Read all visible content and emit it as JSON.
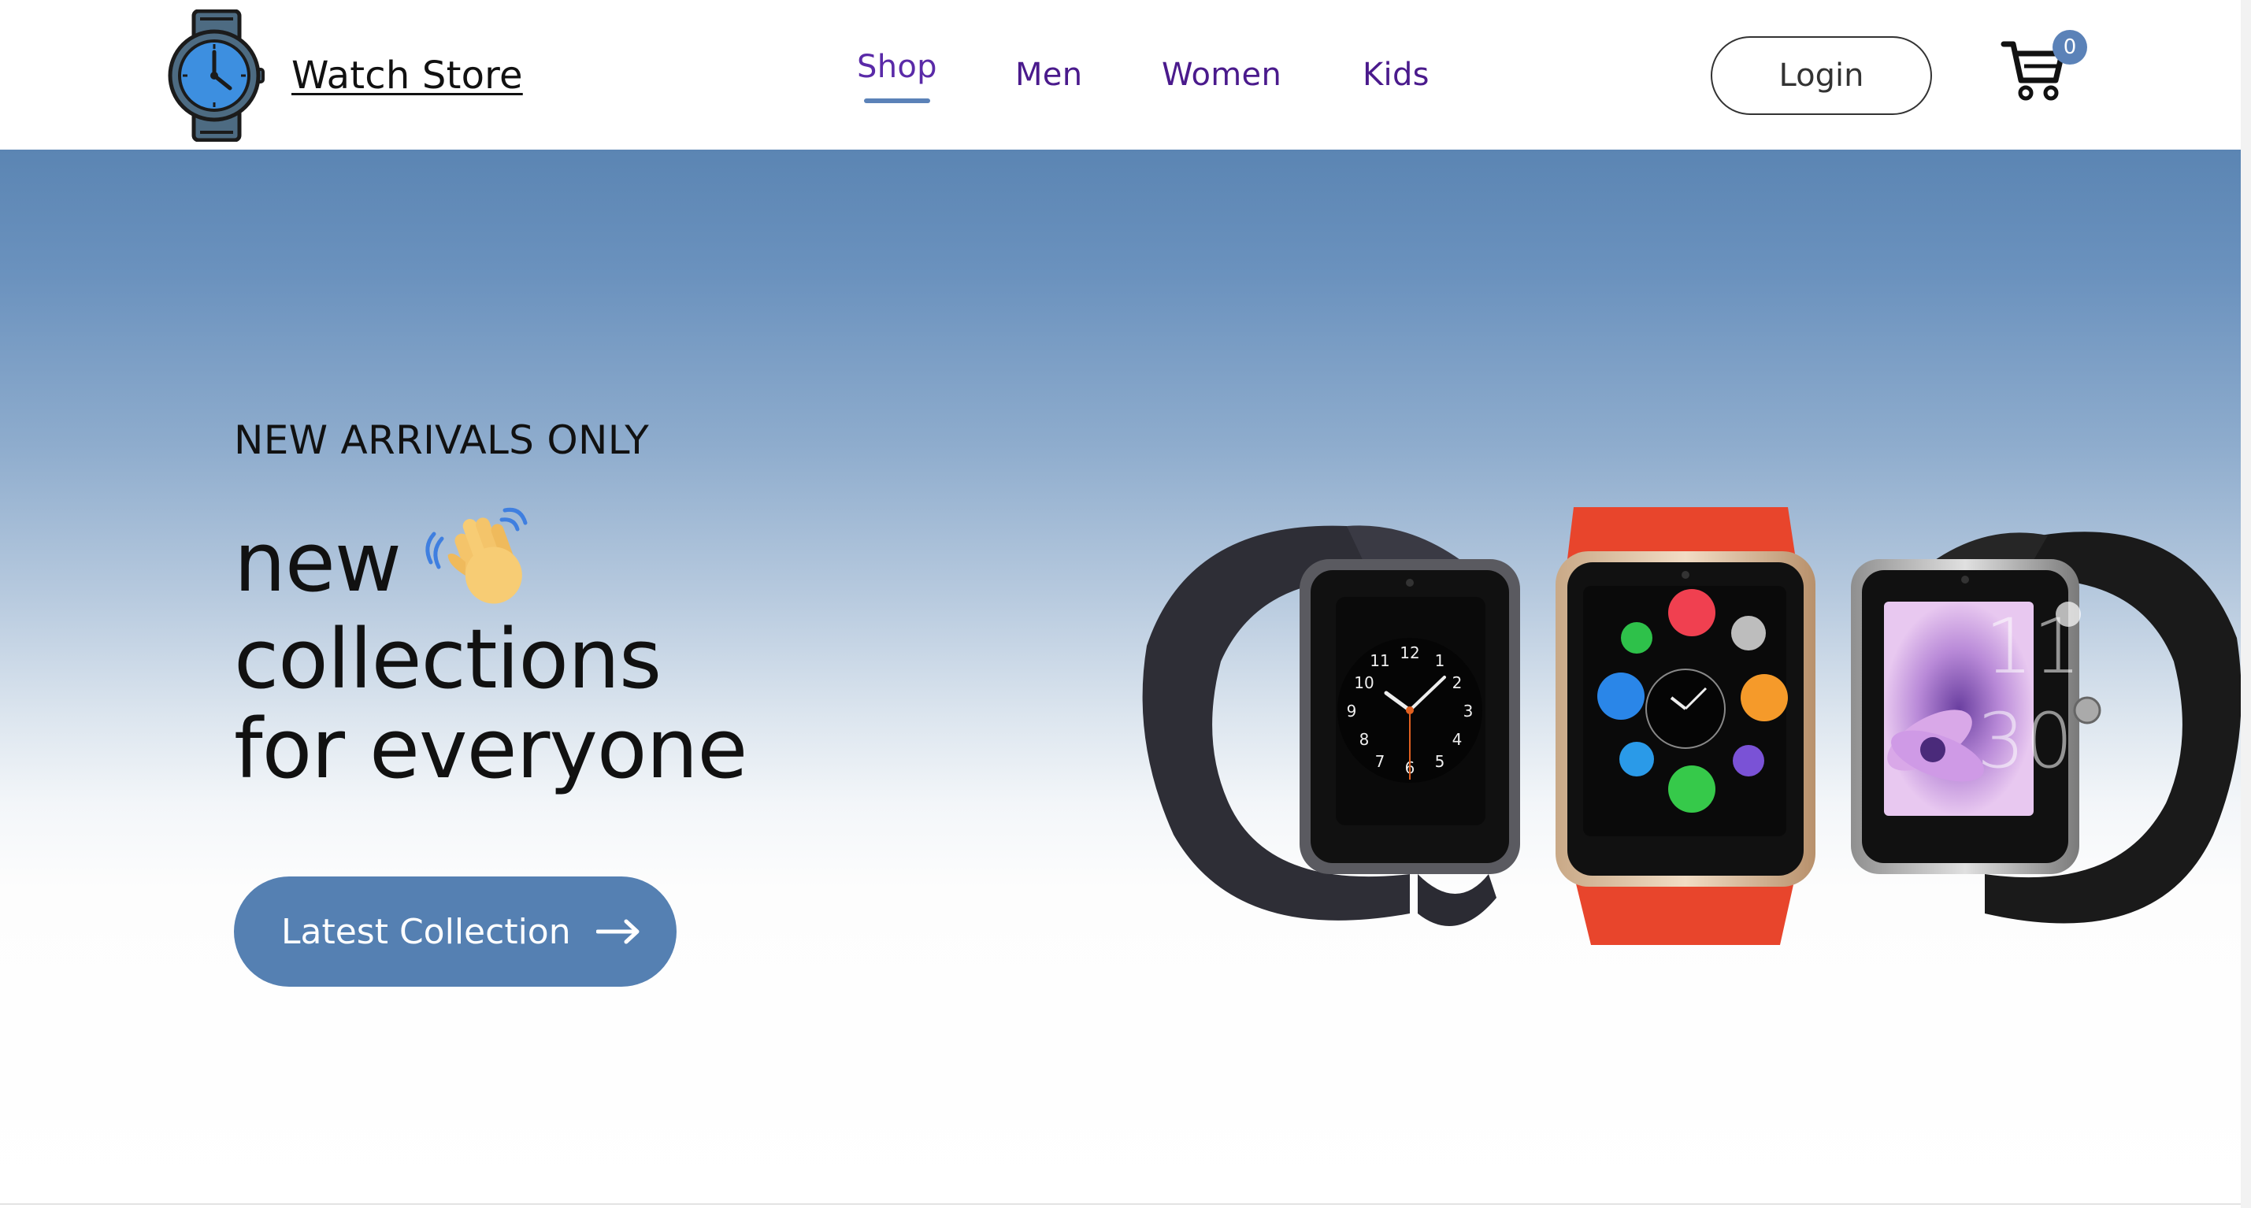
{
  "header": {
    "brand": "Watch Store",
    "nav": [
      {
        "label": "Shop",
        "active": true
      },
      {
        "label": "Men"
      },
      {
        "label": "Women"
      },
      {
        "label": "Kids"
      }
    ],
    "login_label": "Login",
    "cart_count": "0"
  },
  "hero": {
    "eyebrow": "NEW ARRIVALS ONLY",
    "headline_line1": "new",
    "headline_line2": "collections",
    "headline_line3": "for everyone",
    "cta_label": "Latest Collection",
    "watches": [
      "black smartwatch analog face",
      "red smartwatch app menu",
      "black smartwatch flower clock"
    ]
  },
  "colors": {
    "accent": "#5580b2",
    "nav_text": "#4a1a8c",
    "gradient_top": "#5b85b3",
    "gradient_bottom": "#ffffff",
    "red_band": "#e8452c"
  },
  "icons": [
    "watch-logo-icon",
    "cart-icon",
    "waving-hand-icon",
    "arrow-right-icon"
  ]
}
